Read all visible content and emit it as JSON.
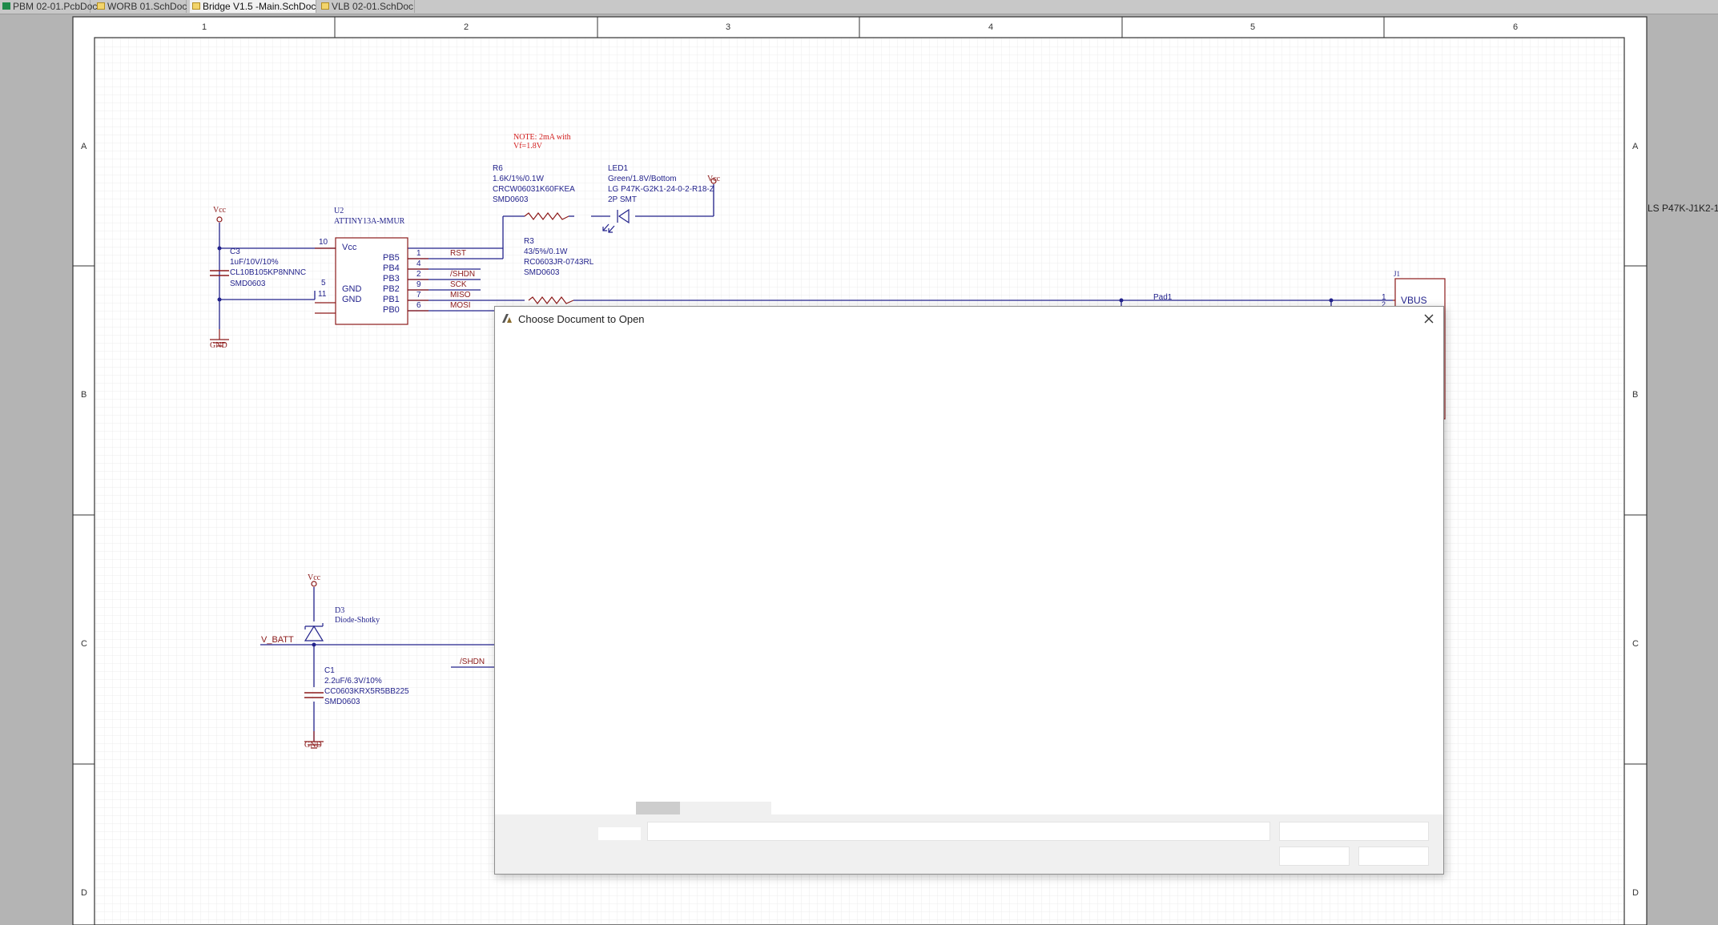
{
  "tabs": [
    {
      "label": "PBM 02-01.PcbDoc",
      "type": "pcb",
      "active": false
    },
    {
      "label": "WORB 01.SchDoc",
      "type": "sch",
      "active": false
    },
    {
      "label": "Bridge V1.5 -Main.SchDoc",
      "type": "sch",
      "active": true
    },
    {
      "label": "VLB 02-01.SchDoc",
      "type": "sch",
      "active": false
    }
  ],
  "sheet": {
    "zones_x": [
      "1",
      "2",
      "3",
      "4",
      "5",
      "6"
    ],
    "zones_y": [
      "A",
      "B",
      "C",
      "D"
    ]
  },
  "components": {
    "u2": {
      "ref": "U2",
      "part": "ATTINY13A-MMUR",
      "left_pins": [
        {
          "num": "10",
          "name": "Vcc"
        },
        {
          "num": "5",
          "name": "GND"
        },
        {
          "num": "11",
          "name": "GND"
        }
      ],
      "right_pins": [
        {
          "num": "1",
          "name": "PB5"
        },
        {
          "num": "4",
          "name": "PB4"
        },
        {
          "num": "2",
          "name": "PB3"
        },
        {
          "num": "9",
          "name": "PB2"
        },
        {
          "num": "7",
          "name": "PB1"
        },
        {
          "num": "6",
          "name": "PB0"
        }
      ]
    },
    "c3": {
      "ref": "C3",
      "value": "1uF/10V/10%",
      "part": "CL10B105KP8NNNC",
      "footprint": "SMD0603"
    },
    "r6": {
      "ref": "R6",
      "value": "1.6K/1%/0.1W",
      "part": "CRCW06031K60FKEA",
      "footprint": "SMD0603"
    },
    "led1": {
      "ref": "LED1",
      "value": "Green/1.8V/Bottom",
      "part": "LG P47K-G2K1-24-0-2-R18-Z",
      "footprint": "2P SMT"
    },
    "r3": {
      "ref": "R3",
      "value": "43/5%/0.1W",
      "part": "RC0603JR-0743RL",
      "footprint": "SMD0603"
    },
    "d3": {
      "ref": "D3",
      "part": "Diode-Shotky"
    },
    "c1": {
      "ref": "C1",
      "value": "2.2uF/6.3V/10%",
      "part": "CC0603KRX5R5BB225",
      "footprint": "SMD0603"
    },
    "j1": {
      "ref": "J1",
      "pin1_num": "1",
      "pin1_name": "VBUS",
      "pin2_num": "2"
    }
  },
  "nets": {
    "rst": "RST",
    "shdn": "/SHDN",
    "sck": "SCK",
    "miso": "MISO",
    "mosi": "MOSI",
    "pad1": "Pad1",
    "vbatt": "V_BATT",
    "shdn2": "/SHDN"
  },
  "power": {
    "vcc": "Vcc",
    "gnd": "GND"
  },
  "note": {
    "line1": "NOTE: 2mA with",
    "line2": "Vf=1.8V"
  },
  "offsheet_text": "LS P47K-J1K2-1",
  "dialog": {
    "title": "Choose Document to Open",
    "filename_label": "",
    "filename_value": "",
    "filetype_value": "",
    "open_label": "",
    "cancel_label": ""
  },
  "colors": {
    "wire": "#23238c",
    "component": "#8c1a1a",
    "component_fill": "#ffffff",
    "grid": "#e9e9e9",
    "border": "#333333",
    "note": "#d21e1e"
  },
  "icons": {
    "close": "close-icon",
    "app": "altium-app-icon",
    "pcb_doc": "pcb-doc-icon",
    "sch_doc": "sch-doc-icon"
  }
}
